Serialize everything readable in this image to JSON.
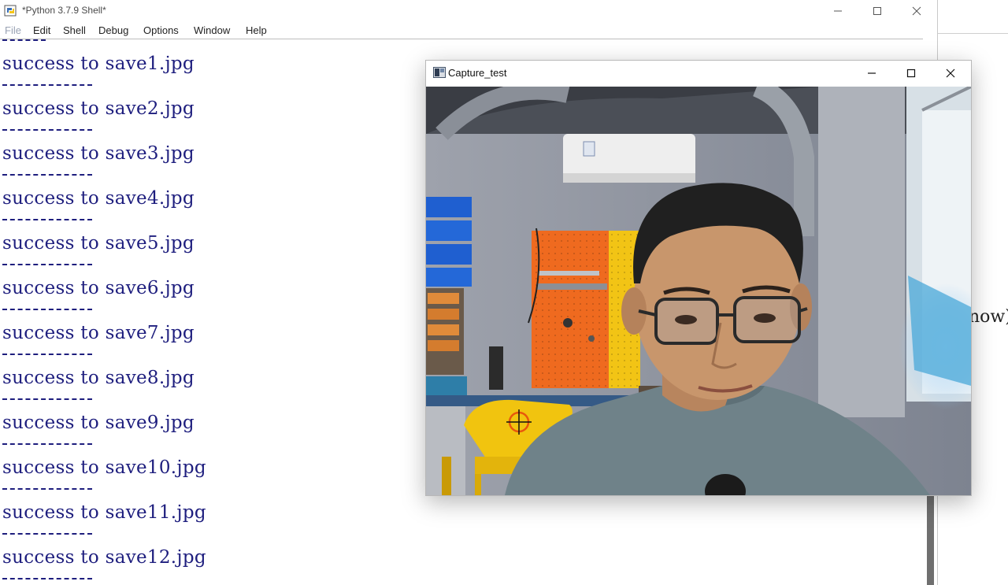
{
  "idle_window": {
    "title": "*Python 3.7.9 Shell*",
    "menu": [
      "File",
      "Edit",
      "Shell",
      "Debug",
      "Options",
      "Window",
      "Help"
    ],
    "shell_lines": [
      "success to save1.jpg",
      "success to save2.jpg",
      "success to save3.jpg",
      "success to save4.jpg",
      "success to save5.jpg",
      "success to save6.jpg",
      "success to save7.jpg",
      "success to save8.jpg",
      "success to save9.jpg",
      "success to save10.jpg",
      "success to save11.jpg",
      "success to save12.jpg"
    ],
    "text_color": "#1e1e7e"
  },
  "capture_window": {
    "title": "Capture_test"
  },
  "background_window": {
    "partial_text": "now)"
  },
  "icons": {
    "idle_app": "python-idle-icon",
    "minimize": "minimize-icon",
    "maximize": "maximize-icon",
    "close": "close-icon",
    "capture_app": "opencv-window-icon",
    "cursor": "crosshair-cursor-icon"
  },
  "colors": {
    "cursor": "#e8580c",
    "wall_board_orange": "#ef6a1f",
    "wall_board_yellow": "#f2c415",
    "bins_blue": "#1f5fd0",
    "chair_yellow": "#f1c40f",
    "shirt": "#6f8289"
  }
}
